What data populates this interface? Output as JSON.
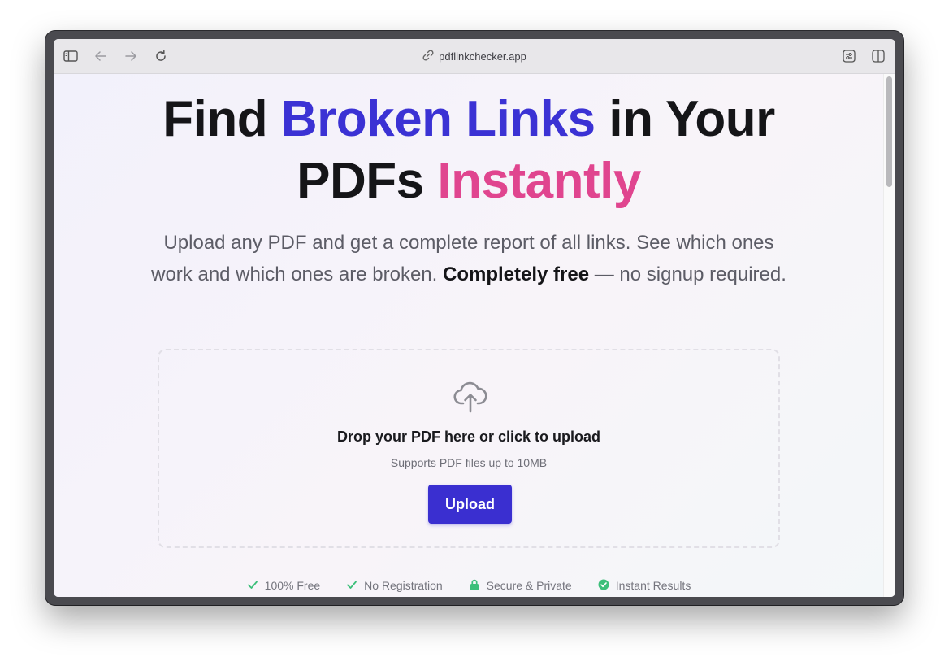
{
  "browser": {
    "url": "pdflinkchecker.app",
    "icons": [
      "sidebar-icon",
      "back-icon",
      "forward-icon",
      "reload-icon",
      "link-icon",
      "extension-icon",
      "split-view-icon"
    ]
  },
  "hero": {
    "title_part1": "Find ",
    "title_highlight1": "Broken Links",
    "title_part2": " in Your",
    "title_part3": "PDFs ",
    "title_highlight2": "Instantly",
    "subtitle_part1": "Upload any PDF and get a complete report of all links. See which ones work and which ones are broken. ",
    "subtitle_bold": "Completely free",
    "subtitle_part2": " — no signup required."
  },
  "dropzone": {
    "title": "Drop your PDF here or click to upload",
    "subtitle": "Supports PDF files up to 10MB",
    "button_label": "Upload"
  },
  "features": [
    {
      "label": "100% Free",
      "icon": "check-icon"
    },
    {
      "label": "No Registration",
      "icon": "check-icon"
    },
    {
      "label": "Secure & Private",
      "icon": "lock-icon"
    },
    {
      "label": "Instant Results",
      "icon": "check-circle-icon"
    }
  ],
  "colors": {
    "accent_blue": "#3b32d4",
    "accent_pink": "#e0458f",
    "button": "#3a2fd0",
    "feature_green": "#3cbf7a"
  }
}
